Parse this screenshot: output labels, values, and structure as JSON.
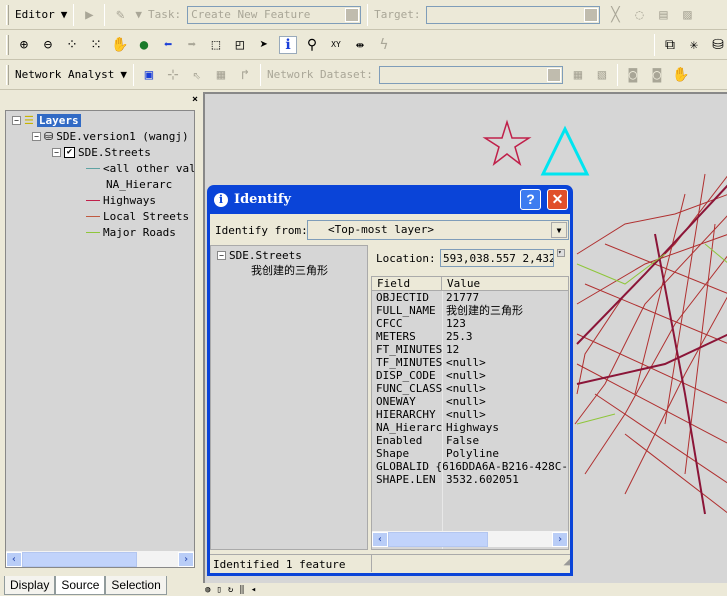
{
  "editor_toolbar": {
    "editor_label": "Editor",
    "task_label": "Task:",
    "task_value": "Create New Feature",
    "target_label": "Target:"
  },
  "network_toolbar": {
    "label": "Network Analyst",
    "dataset_label": "Network Dataset:"
  },
  "toc": {
    "root": "Layers",
    "workspace": "SDE.version1 (wangj)",
    "layer": "SDE.Streets",
    "legend_items": [
      {
        "label": "<all other valu",
        "color": "#5fa3a3"
      },
      {
        "label": "NA_Hierarc",
        "color": ""
      },
      {
        "label": "Highways",
        "color": "#c0204a"
      },
      {
        "label": "Local Streets",
        "color": "#c05a40"
      },
      {
        "label": "Major Roads",
        "color": "#8fc63b"
      }
    ],
    "tabs": [
      "Display",
      "Source",
      "Selection"
    ]
  },
  "identify": {
    "title": "Identify",
    "from_label": "Identify from:",
    "from_value": "<Top-most layer>",
    "tree_layer": "SDE.Streets",
    "tree_feature": "我创建的三角形",
    "location_label": "Location:",
    "location_value": "593,038.557  2,432",
    "col_field": "Field",
    "col_value": "Value",
    "rows": [
      [
        "OBJECTID",
        "21777"
      ],
      [
        "FULL_NAME",
        "我创建的三角形"
      ],
      [
        "CFCC",
        "123"
      ],
      [
        "METERS",
        "25.3"
      ],
      [
        "FT_MINUTES",
        "12"
      ],
      [
        "TF_MINUTES",
        "<null>"
      ],
      [
        "DISP_CODE",
        "<null>"
      ],
      [
        "FUNC_CLASS",
        "<null>"
      ],
      [
        "ONEWAY",
        "<null>"
      ],
      [
        "HIERARCHY",
        "<null>"
      ],
      [
        "NA_Hierarc",
        "Highways"
      ],
      [
        "Enabled",
        "False"
      ],
      [
        "Shape",
        "Polyline"
      ],
      [
        "GLOBALID",
        "{616DDA6A-B216-428C-"
      ],
      [
        "SHAPE.LEN",
        "3532.602051"
      ]
    ],
    "status": "Identified 1 feature"
  }
}
